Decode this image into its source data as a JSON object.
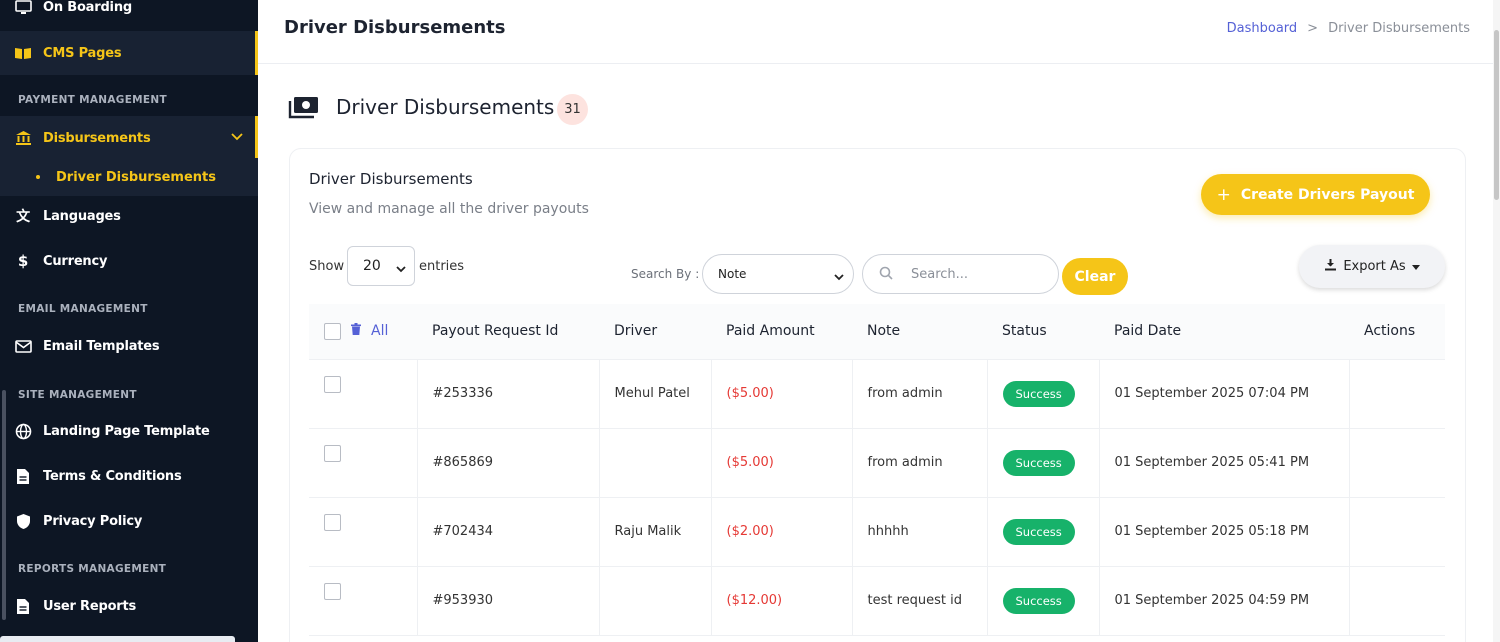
{
  "sidebar": {
    "items_top": [
      {
        "label": "On Boarding",
        "icon": "monitor-icon"
      },
      {
        "label": "CMS Pages",
        "icon": "book-icon",
        "active": true
      }
    ],
    "section_payment": "PAYMENT MANAGEMENT",
    "disbursements": {
      "label": "Disbursements",
      "icon": "bank-icon"
    },
    "sub_item": "Driver Disbursements",
    "languages": "Languages",
    "currency": "Currency",
    "section_email": "EMAIL MANAGEMENT",
    "email_templates": "Email Templates",
    "section_site": "SITE MANAGEMENT",
    "landing_page": "Landing Page Template",
    "terms": "Terms & Conditions",
    "privacy": "Privacy Policy",
    "section_reports": "REPORTS MANAGEMENT",
    "user_reports": "User Reports"
  },
  "header": {
    "title": "Driver Disbursements",
    "breadcrumb_home": "Dashboard",
    "breadcrumb_sep": ">",
    "breadcrumb_current": "Driver Disbursements"
  },
  "page": {
    "heading": "Driver Disbursements",
    "count": "31"
  },
  "card": {
    "title": "Driver Disbursements",
    "subtitle": "View and manage all the driver payouts",
    "create_button": "Create Drivers Payout",
    "create_plus": "+"
  },
  "controls": {
    "show_label": "Show",
    "entries_value": "20",
    "entries_label": "entries",
    "search_by_label": "Search By :",
    "search_by_value": "Note",
    "search_placeholder": "Search...",
    "clear_button": "Clear",
    "export_button": "Export As"
  },
  "table": {
    "all_label": "All",
    "columns": [
      "Payout Request Id",
      "Driver",
      "Paid Amount",
      "Note",
      "Status",
      "Paid Date",
      "Actions"
    ],
    "rows": [
      {
        "id": "#253336",
        "driver": "Mehul Patel",
        "amount": "($5.00)",
        "note": "from admin",
        "status": "Success",
        "date": "01 September 2025 07:04 PM"
      },
      {
        "id": "#865869",
        "driver": "",
        "amount": "($5.00)",
        "note": "from admin",
        "status": "Success",
        "date": "01 September 2025 05:41 PM"
      },
      {
        "id": "#702434",
        "driver": "Raju Malik",
        "amount": "($2.00)",
        "note": "hhhhh",
        "status": "Success",
        "date": "01 September 2025 05:18 PM"
      },
      {
        "id": "#953930",
        "driver": "",
        "amount": "($12.00)",
        "note": "test request id",
        "status": "Success",
        "date": "01 September 2025 04:59 PM"
      }
    ]
  },
  "colors": {
    "accent": "#f5c518",
    "sidebar_bg": "#0d1624",
    "success": "#17b26a",
    "negative": "#e53935",
    "link": "#5561d6"
  }
}
